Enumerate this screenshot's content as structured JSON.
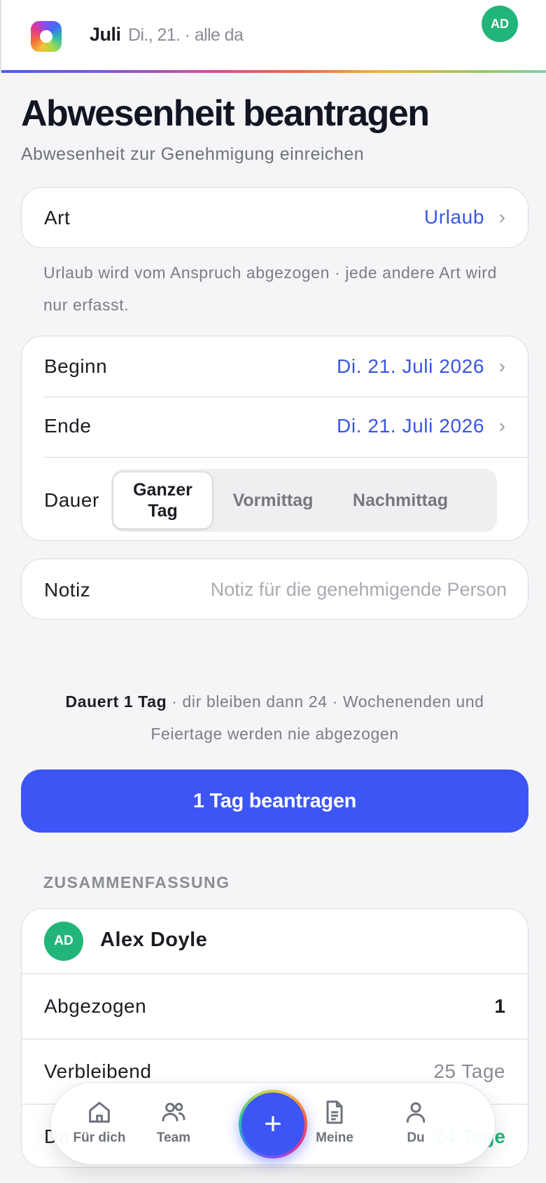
{
  "header": {
    "brand": "Juli",
    "status": "Di., 21. · alle da",
    "avatar_initials": "AD"
  },
  "page": {
    "title": "Abwesenheit beantragen",
    "subtitle": "Abwesenheit zur Genehmigung einreichen"
  },
  "type_card": {
    "label": "Art",
    "value": "Urlaub",
    "hint": "Urlaub wird vom Anspruch abgezogen · jede andere Art wird nur erfasst."
  },
  "date_card": {
    "start_label": "Beginn",
    "start_value": "Di. 21. Juli 2026",
    "end_label": "Ende",
    "end_value": "Di. 21. Juli 2026",
    "duration_label": "Dauer",
    "duration_options": [
      "Ganzer Tag",
      "Vormittag",
      "Nachmittag"
    ],
    "duration_selected": "Ganzer Tag"
  },
  "note": {
    "label": "Notiz",
    "placeholder": "Notiz für die genehmigende Person"
  },
  "duration_info": {
    "bold": "Dauert 1 Tag",
    "rest": " · dir bleiben dann 24 · Wochenenden und Feiertage werden nie abgezogen"
  },
  "submit_button": "1 Tag beantragen",
  "summary": {
    "section_title": "ZUSAMMENFASSUNG",
    "avatar_initials": "AD",
    "name": "Alex Doyle",
    "deducted_label": "Abgezogen",
    "deducted_value": "1",
    "remaining_label": "Verbleibend",
    "remaining_value": "25 Tage",
    "last_label": "Da",
    "last_value": "24 Tage"
  },
  "tabbar": {
    "items": [
      {
        "label": "Für dich",
        "icon": "home-icon"
      },
      {
        "label": "Team",
        "icon": "users-icon"
      },
      {
        "label": "",
        "icon": "plus-icon"
      },
      {
        "label": "Meine",
        "icon": "document-icon"
      },
      {
        "label": "Du",
        "icon": "user-icon"
      }
    ],
    "fab_symbol": "+"
  },
  "colors": {
    "accent": "#3d55f5",
    "link": "#3a55e6",
    "success": "#22b57a",
    "background": "#f5f5f7"
  }
}
